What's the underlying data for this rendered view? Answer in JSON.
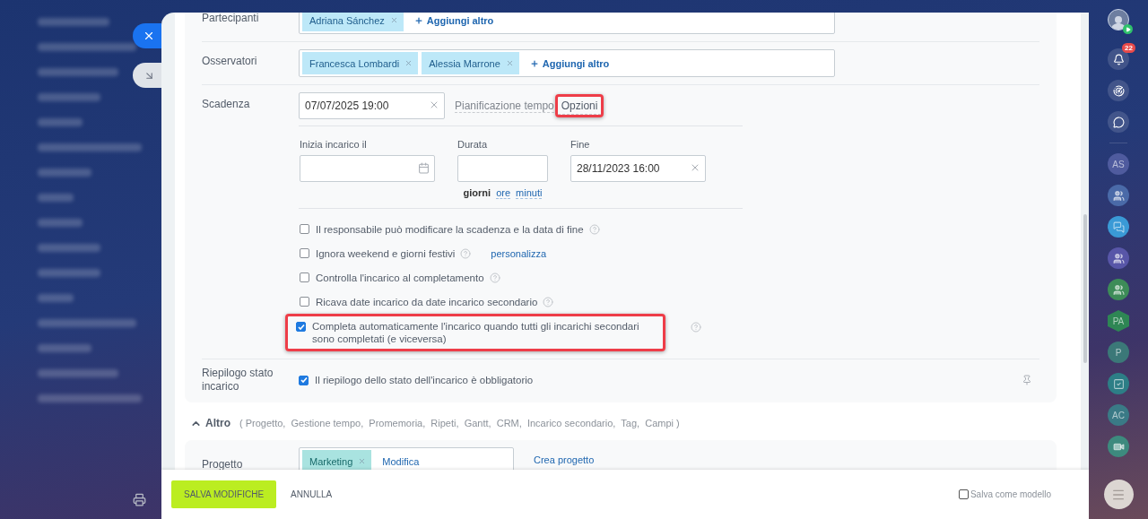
{
  "participants": {
    "label": "Partecipanti",
    "tags": [
      "Adriana Sánchez"
    ],
    "add_link": "Aggiungi altro"
  },
  "observers": {
    "label": "Osservatori",
    "tags": [
      "Francesca Lombardi",
      "Alessia Marrone"
    ],
    "add_link": "Aggiungi altro"
  },
  "deadline": {
    "label": "Scadenza",
    "value": "07/07/2025 19:00",
    "planning_label": "Pianificazione tempo",
    "options_link": {
      "text": "Opzioni",
      "highlighted": true
    },
    "start": {
      "label": "Inizia incarico il"
    },
    "duration": {
      "label": "Durata",
      "units": [
        {
          "text": "giorni",
          "selected": true
        },
        {
          "text": "ore",
          "selected": false
        },
        {
          "text": "minuti",
          "selected": false
        }
      ]
    },
    "end": {
      "label": "Fine",
      "value": "28/11/2023 16:00"
    },
    "options": [
      {
        "text": "Il responsabile può modificare la scadenza e la data di fine",
        "checked": false,
        "highlighted": false
      },
      {
        "text": "Ignora weekend e giorni festivi",
        "checked": false,
        "highlighted": false,
        "link": "personalizza"
      },
      {
        "text": "Controlla l'incarico al completamento",
        "checked": false,
        "highlighted": false
      },
      {
        "text": "Ricava date incarico da date incarico secondario",
        "checked": false,
        "highlighted": false
      },
      {
        "text": "Completa automaticamente l'incarico quando tutti gli incarichi secondari sono completati (e viceversa)",
        "checked": true,
        "highlighted": true
      }
    ]
  },
  "status_summary": {
    "label": "Riepilogo stato incarico",
    "option": {
      "text": "Il riepilogo dello stato dell'incarico è obbligatorio",
      "checked": true
    }
  },
  "more": {
    "title": "Altro",
    "expanded": true,
    "sections": "( Progetto,  Gestione tempo,  Promemoria,  Ripeti,  Gantt,  CRM,  Incarico secondario,  Tag,  Campi )"
  },
  "project": {
    "label": "Progetto",
    "tag": "Marketing",
    "edit_link": "Modifica",
    "create_link": "Crea progetto"
  },
  "footer": {
    "save": "SALVA MODIFICHE",
    "cancel": "ANNULLA",
    "template": {
      "text": "Salva come modello",
      "checked": false
    }
  },
  "right_bar": {
    "notifications": "22",
    "items": [
      {
        "kind": "initials",
        "text": "AS",
        "color": "#4f5b9e"
      },
      {
        "kind": "group",
        "color": "#4a6aa8"
      },
      {
        "kind": "chat",
        "color": "#3a9ad6"
      },
      {
        "kind": "group",
        "color": "#5856a8"
      },
      {
        "kind": "group",
        "color": "#3d8c58"
      },
      {
        "kind": "hexagon",
        "text": "PA",
        "color": "#2e8654"
      },
      {
        "kind": "initials",
        "text": "P",
        "color": "#3b7878"
      },
      {
        "kind": "task",
        "color": "#2d7e86"
      },
      {
        "kind": "initials",
        "text": "AC",
        "color": "#3a7a86"
      },
      {
        "kind": "video",
        "color": "#3d8a7e"
      }
    ]
  }
}
